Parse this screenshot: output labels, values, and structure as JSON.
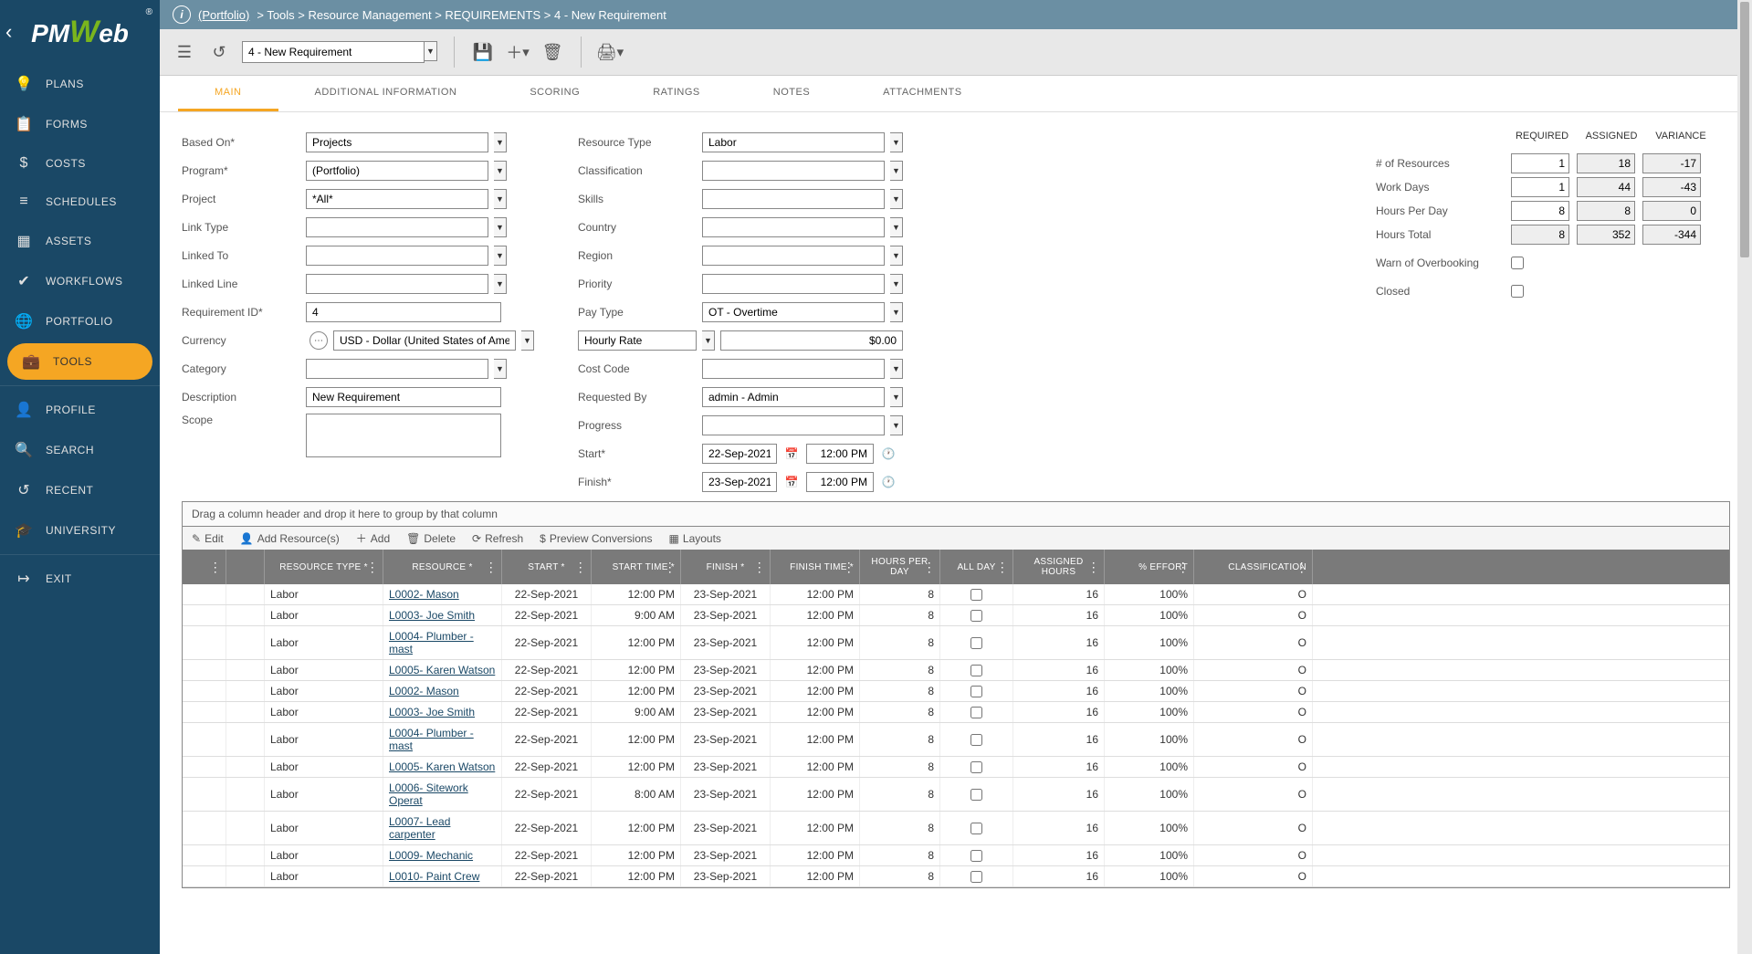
{
  "logo": {
    "brand": "PMWeb"
  },
  "nav": [
    {
      "icon": "💡",
      "label": "PLANS"
    },
    {
      "icon": "📋",
      "label": "FORMS"
    },
    {
      "icon": "$",
      "label": "COSTS"
    },
    {
      "icon": "≡",
      "label": "SCHEDULES"
    },
    {
      "icon": "▦",
      "label": "ASSETS"
    },
    {
      "icon": "✔",
      "label": "WORKFLOWS"
    },
    {
      "icon": "🌐",
      "label": "PORTFOLIO"
    },
    {
      "icon": "💼",
      "label": "TOOLS",
      "active": true
    }
  ],
  "nav2": [
    {
      "icon": "👤",
      "label": "PROFILE"
    },
    {
      "icon": "🔍",
      "label": "SEARCH"
    },
    {
      "icon": "↺",
      "label": "RECENT"
    },
    {
      "icon": "🎓",
      "label": "UNIVERSITY"
    }
  ],
  "nav3": [
    {
      "icon": "↦",
      "label": "EXIT"
    }
  ],
  "breadcrumb": {
    "portfolio": "(Portfolio)",
    "rest": "> Tools > Resource Management > REQUIREMENTS > 4 - New Requirement"
  },
  "toolbar": {
    "select_value": "4 - New Requirement"
  },
  "tabs": [
    "MAIN",
    "ADDITIONAL INFORMATION",
    "SCORING",
    "RATINGS",
    "NOTES",
    "ATTACHMENTS"
  ],
  "form": {
    "col1": {
      "based_on": {
        "label": "Based On*",
        "value": "Projects"
      },
      "program": {
        "label": "Program*",
        "value": "(Portfolio)"
      },
      "project": {
        "label": "Project",
        "value": "*All*"
      },
      "link_type": {
        "label": "Link Type",
        "value": ""
      },
      "linked_to": {
        "label": "Linked To",
        "value": ""
      },
      "linked_line": {
        "label": "Linked Line",
        "value": ""
      },
      "req_id": {
        "label": "Requirement ID*",
        "value": "4"
      },
      "currency": {
        "label": "Currency",
        "value": "USD - Dollar (United States of Ameri"
      },
      "category": {
        "label": "Category",
        "value": ""
      },
      "description": {
        "label": "Description",
        "value": "New Requirement"
      },
      "scope": {
        "label": "Scope",
        "value": ""
      }
    },
    "col2": {
      "resource_type": {
        "label": "Resource Type",
        "value": "Labor"
      },
      "classification": {
        "label": "Classification",
        "value": ""
      },
      "skills": {
        "label": "Skills",
        "value": ""
      },
      "country": {
        "label": "Country",
        "value": ""
      },
      "region": {
        "label": "Region",
        "value": ""
      },
      "priority": {
        "label": "Priority",
        "value": ""
      },
      "pay_type": {
        "label": "Pay Type",
        "value": "OT - Overtime"
      },
      "rate_type": {
        "value": "Hourly Rate"
      },
      "rate_value": {
        "value": "$0.00"
      },
      "cost_code": {
        "label": "Cost Code",
        "value": ""
      },
      "requested_by": {
        "label": "Requested By",
        "value": "admin - Admin"
      },
      "progress": {
        "label": "Progress",
        "value": ""
      },
      "start": {
        "label": "Start*",
        "date": "22-Sep-2021",
        "time": "12:00 PM"
      },
      "finish": {
        "label": "Finish*",
        "date": "23-Sep-2021",
        "time": "12:00 PM"
      }
    },
    "summary": {
      "headers": {
        "req": "REQUIRED",
        "ass": "ASSIGNED",
        "var": "VARIANCE"
      },
      "rows": [
        {
          "label": "# of Resources",
          "req": "1",
          "ass": "18",
          "var": "-17"
        },
        {
          "label": "Work Days",
          "req": "1",
          "ass": "44",
          "var": "-43"
        },
        {
          "label": "Hours Per Day",
          "req": "8",
          "ass": "8",
          "var": "0"
        },
        {
          "label": "Hours Total",
          "req": "8",
          "ass": "352",
          "var": "-344",
          "req_ro": true
        }
      ],
      "warn": {
        "label": "Warn of Overbooking"
      },
      "closed": {
        "label": "Closed"
      }
    }
  },
  "grid": {
    "group_hint": "Drag a column header and drop it here to group by that column",
    "toolbar": {
      "edit": "Edit",
      "add_res": "Add Resource(s)",
      "add": "Add",
      "delete": "Delete",
      "refresh": "Refresh",
      "preview": "Preview Conversions",
      "layouts": "Layouts"
    },
    "headers": {
      "type": "RESOURCE TYPE *",
      "res": "RESOURCE *",
      "start": "START *",
      "stime": "START TIME *",
      "finish": "FINISH *",
      "ftime": "FINISH TIME *",
      "hpd": "HOURS PER DAY",
      "allday": "ALL DAY",
      "ahours": "ASSIGNED HOURS",
      "effort": "% EFFORT",
      "class": "CLASSIFICATION"
    },
    "rows": [
      {
        "type": "Labor",
        "res": "L0002- Mason",
        "start": "22-Sep-2021",
        "stime": "12:00 PM",
        "finish": "23-Sep-2021",
        "ftime": "12:00 PM",
        "hpd": "8",
        "ahours": "16",
        "effort": "100%",
        "class": "O"
      },
      {
        "type": "Labor",
        "res": "L0003- Joe Smith",
        "start": "22-Sep-2021",
        "stime": "9:00 AM",
        "finish": "23-Sep-2021",
        "ftime": "12:00 PM",
        "hpd": "8",
        "ahours": "16",
        "effort": "100%",
        "class": "O"
      },
      {
        "type": "Labor",
        "res": "L0004- Plumber - mast",
        "start": "22-Sep-2021",
        "stime": "12:00 PM",
        "finish": "23-Sep-2021",
        "ftime": "12:00 PM",
        "hpd": "8",
        "ahours": "16",
        "effort": "100%",
        "class": "O"
      },
      {
        "type": "Labor",
        "res": "L0005- Karen Watson",
        "start": "22-Sep-2021",
        "stime": "12:00 PM",
        "finish": "23-Sep-2021",
        "ftime": "12:00 PM",
        "hpd": "8",
        "ahours": "16",
        "effort": "100%",
        "class": "O"
      },
      {
        "type": "Labor",
        "res": "L0002- Mason",
        "start": "22-Sep-2021",
        "stime": "12:00 PM",
        "finish": "23-Sep-2021",
        "ftime": "12:00 PM",
        "hpd": "8",
        "ahours": "16",
        "effort": "100%",
        "class": "O"
      },
      {
        "type": "Labor",
        "res": "L0003- Joe Smith",
        "start": "22-Sep-2021",
        "stime": "9:00 AM",
        "finish": "23-Sep-2021",
        "ftime": "12:00 PM",
        "hpd": "8",
        "ahours": "16",
        "effort": "100%",
        "class": "O"
      },
      {
        "type": "Labor",
        "res": "L0004- Plumber - mast",
        "start": "22-Sep-2021",
        "stime": "12:00 PM",
        "finish": "23-Sep-2021",
        "ftime": "12:00 PM",
        "hpd": "8",
        "ahours": "16",
        "effort": "100%",
        "class": "O"
      },
      {
        "type": "Labor",
        "res": "L0005- Karen Watson",
        "start": "22-Sep-2021",
        "stime": "12:00 PM",
        "finish": "23-Sep-2021",
        "ftime": "12:00 PM",
        "hpd": "8",
        "ahours": "16",
        "effort": "100%",
        "class": "O"
      },
      {
        "type": "Labor",
        "res": "L0006- Sitework Operat",
        "start": "22-Sep-2021",
        "stime": "8:00 AM",
        "finish": "23-Sep-2021",
        "ftime": "12:00 PM",
        "hpd": "8",
        "ahours": "16",
        "effort": "100%",
        "class": "O"
      },
      {
        "type": "Labor",
        "res": "L0007- Lead carpenter",
        "start": "22-Sep-2021",
        "stime": "12:00 PM",
        "finish": "23-Sep-2021",
        "ftime": "12:00 PM",
        "hpd": "8",
        "ahours": "16",
        "effort": "100%",
        "class": "O"
      },
      {
        "type": "Labor",
        "res": "L0009- Mechanic",
        "start": "22-Sep-2021",
        "stime": "12:00 PM",
        "finish": "23-Sep-2021",
        "ftime": "12:00 PM",
        "hpd": "8",
        "ahours": "16",
        "effort": "100%",
        "class": "O"
      },
      {
        "type": "Labor",
        "res": "L0010- Paint Crew",
        "start": "22-Sep-2021",
        "stime": "12:00 PM",
        "finish": "23-Sep-2021",
        "ftime": "12:00 PM",
        "hpd": "8",
        "ahours": "16",
        "effort": "100%",
        "class": "O"
      }
    ]
  }
}
